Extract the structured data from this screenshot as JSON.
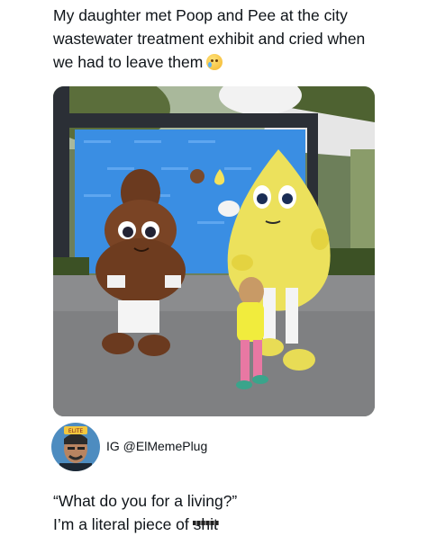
{
  "post": {
    "text": "My daughter met Poop and Pee at the city wastewater treatment exhibit and cried when we had to leave them",
    "emoji": "sad-face-emoji"
  },
  "avatar": {
    "badge": "ELITE"
  },
  "caption": {
    "handle": "IG @ElMemePlug",
    "line1": "“What do you for a living?”",
    "line2_prefix": "I’m a literal piece of ",
    "line2_redacted": "shit"
  }
}
